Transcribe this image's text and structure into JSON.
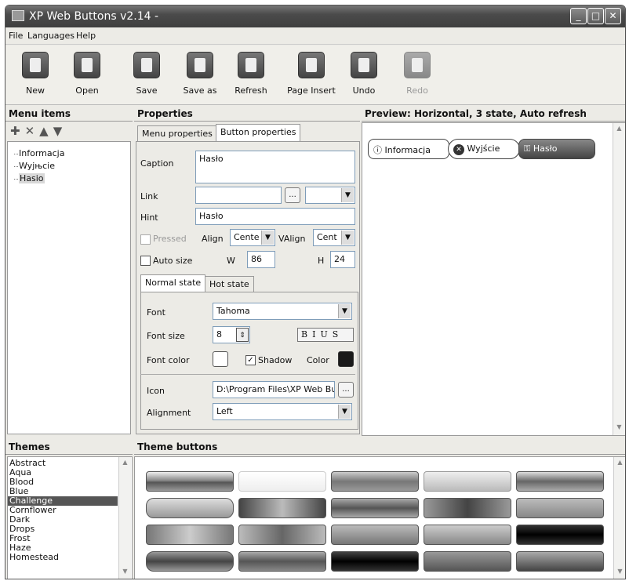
{
  "window": {
    "title": "XP Web Buttons v2.14 -"
  },
  "menu": [
    "File",
    "Languages",
    "Help"
  ],
  "toolbar": [
    {
      "label": "New",
      "icon": "new-icon",
      "enabled": true
    },
    {
      "label": "Open",
      "icon": "open-icon",
      "enabled": true
    },
    {
      "label": "Save",
      "icon": "save-icon",
      "enabled": true
    },
    {
      "label": "Save as",
      "icon": "save-as-icon",
      "enabled": true
    },
    {
      "label": "Refresh",
      "icon": "refresh-icon",
      "enabled": true
    },
    {
      "label": "Page Insert",
      "icon": "page-insert-icon",
      "enabled": true
    },
    {
      "label": "Undo",
      "icon": "undo-icon",
      "enabled": true
    },
    {
      "label": "Redo",
      "icon": "redo-icon",
      "enabled": false
    }
  ],
  "menu_items": {
    "title": "Menu items",
    "items": [
      "Informacja",
      "Wyjњcie",
      "Hasio"
    ],
    "selected": "Hasio"
  },
  "properties": {
    "title": "Properties",
    "tabs": [
      "Menu properties",
      "Button properties"
    ],
    "active_tab": "Button properties",
    "caption_label": "Caption",
    "caption_value": "Hasło",
    "link_label": "Link",
    "link_value": "",
    "hint_label": "Hint",
    "hint_value": "Hasło",
    "pressed_label": "Pressed",
    "align_label": "Align",
    "align_value": "Cente",
    "valign_label": "VAlign",
    "valign_value": "Cent",
    "autosize_label": "Auto size",
    "w_label": "W",
    "w_value": "86",
    "h_label": "H",
    "h_value": "24",
    "state_tabs": [
      "Normal state",
      "Hot state"
    ],
    "font_label": "Font",
    "font_value": "Tahoma",
    "fontsize_label": "Font size",
    "fontsize_value": "8",
    "style_buttons": [
      "B",
      "I",
      "U",
      "S"
    ],
    "fontcolor_label": "Font color",
    "shadow_label": "Shadow",
    "color_label": "Color",
    "icon_label": "Icon",
    "icon_value": "D:\\Program Files\\XP Web Bu",
    "alignment_label": "Alignment",
    "alignment_value": "Left",
    "ellipsis": "..."
  },
  "preview": {
    "title": "Preview: Horizontal, 3 state, Auto refresh",
    "buttons": [
      {
        "label": "Informacja",
        "icon": "info-icon"
      },
      {
        "label": "Wyjście",
        "icon": "close-circle-icon"
      },
      {
        "label": "Hasło",
        "icon": "key-icon"
      }
    ]
  },
  "themes": {
    "title": "Themes",
    "items": [
      "Abstract",
      "Aqua",
      "Blood",
      "Blue",
      "Challenge",
      "Cornflower",
      "Dark",
      "Drops",
      "Frost",
      "Haze",
      "Homestead"
    ],
    "selected": "Challenge"
  },
  "theme_buttons": {
    "title": "Theme buttons"
  },
  "colors": {
    "title_bar": "#4b4b4b",
    "selected": "#555555",
    "window_bg": "#ecebe6"
  }
}
